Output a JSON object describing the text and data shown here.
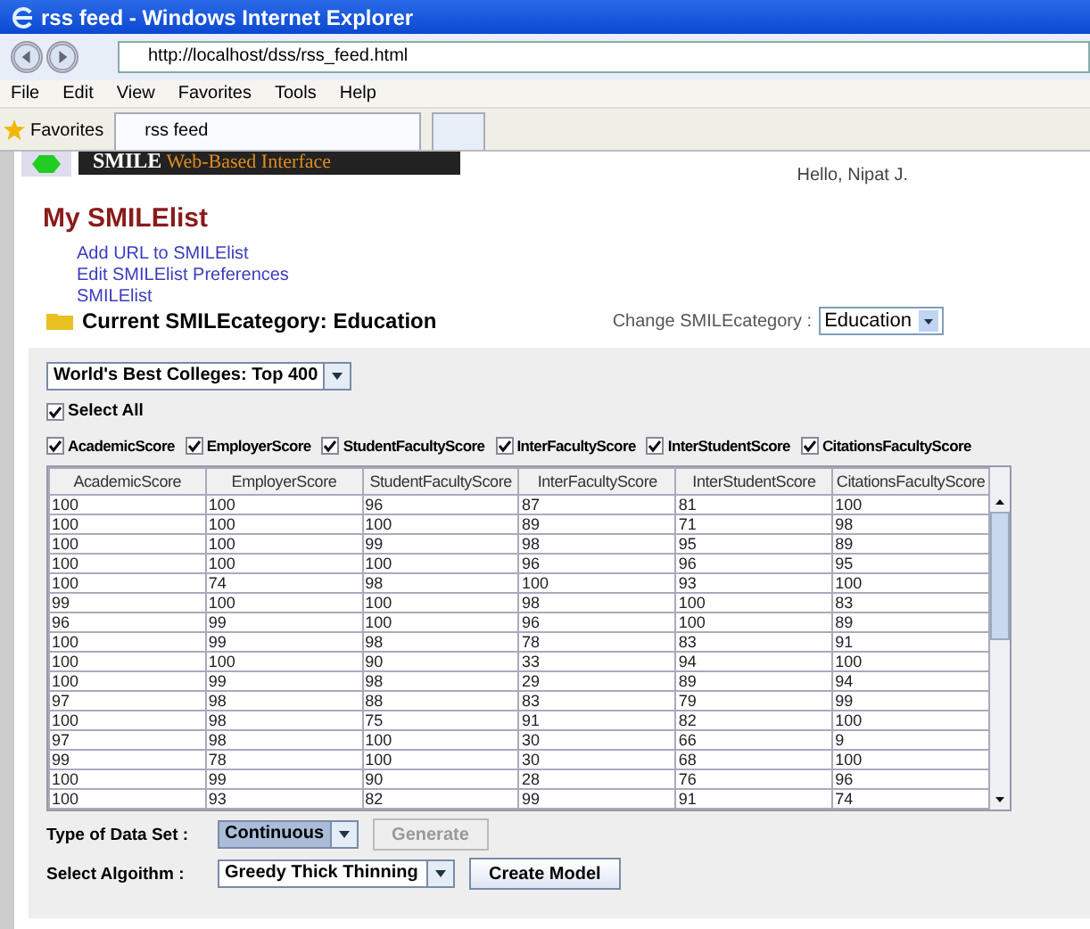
{
  "window": {
    "title": "rss feed - Windows Internet Explorer"
  },
  "address_bar": {
    "url": "http://localhost/dss/rss_feed.html"
  },
  "menu": [
    "File",
    "Edit",
    "View",
    "Favorites",
    "Tools",
    "Help"
  ],
  "favorites_bar": {
    "label": "Favorites",
    "tabs": [
      {
        "label": "rss feed",
        "selected": true
      }
    ]
  },
  "banner": {
    "brand": "SMILE",
    "subtitle": "Web-Based Interface"
  },
  "greeting": "Hello, Nipat J.",
  "heading": "My SMILElist",
  "links": [
    "Add URL to SMILElist",
    "Edit SMILElist Preferences",
    "SMILElist"
  ],
  "current_category": "Current SMILEcategory: Education",
  "change_category": {
    "label": "Change SMILEcategory :",
    "value": "Education"
  },
  "dataset_select": {
    "value": "World's Best Colleges: Top 400"
  },
  "select_all": {
    "label": "Select All",
    "checked": true
  },
  "attributes": [
    {
      "label": "AcademicScore",
      "checked": true
    },
    {
      "label": "EmployerScore",
      "checked": true
    },
    {
      "label": "StudentFacultyScore",
      "checked": true
    },
    {
      "label": "InterFacultyScore",
      "checked": true
    },
    {
      "label": "InterStudentScore",
      "checked": true
    },
    {
      "label": "CitationsFacultyScore",
      "checked": true
    }
  ],
  "table": {
    "columns": [
      "AcademicScore",
      "EmployerScore",
      "StudentFacultyScore",
      "InterFacultyScore",
      "InterStudentScore",
      "CitationsFacultyScore"
    ],
    "rows": [
      [
        "100",
        "100",
        "96",
        "87",
        "81",
        "100"
      ],
      [
        "100",
        "100",
        "100",
        "89",
        "71",
        "98"
      ],
      [
        "100",
        "100",
        "99",
        "98",
        "95",
        "89"
      ],
      [
        "100",
        "100",
        "100",
        "96",
        "96",
        "95"
      ],
      [
        "100",
        "74",
        "98",
        "100",
        "93",
        "100"
      ],
      [
        "99",
        "100",
        "100",
        "98",
        "100",
        "83"
      ],
      [
        "96",
        "99",
        "100",
        "96",
        "100",
        "89"
      ],
      [
        "100",
        "99",
        "98",
        "78",
        "83",
        "91"
      ],
      [
        "100",
        "100",
        "90",
        "33",
        "94",
        "100"
      ],
      [
        "100",
        "99",
        "98",
        "29",
        "89",
        "94"
      ],
      [
        "97",
        "98",
        "88",
        "83",
        "79",
        "99"
      ],
      [
        "100",
        "98",
        "75",
        "91",
        "82",
        "100"
      ],
      [
        "97",
        "98",
        "100",
        "30",
        "66",
        "9"
      ],
      [
        "99",
        "78",
        "100",
        "30",
        "68",
        "100"
      ],
      [
        "100",
        "99",
        "90",
        "28",
        "76",
        "96"
      ],
      [
        "100",
        "93",
        "82",
        "99",
        "91",
        "74"
      ]
    ]
  },
  "data_type": {
    "label": "Type of Data Set :",
    "value": "Continuous",
    "generate": {
      "label": "Generate",
      "disabled": true
    }
  },
  "algorithm": {
    "label": "Select Algoithm :",
    "value": "Greedy Thick Thinning",
    "button": "Create Model"
  }
}
